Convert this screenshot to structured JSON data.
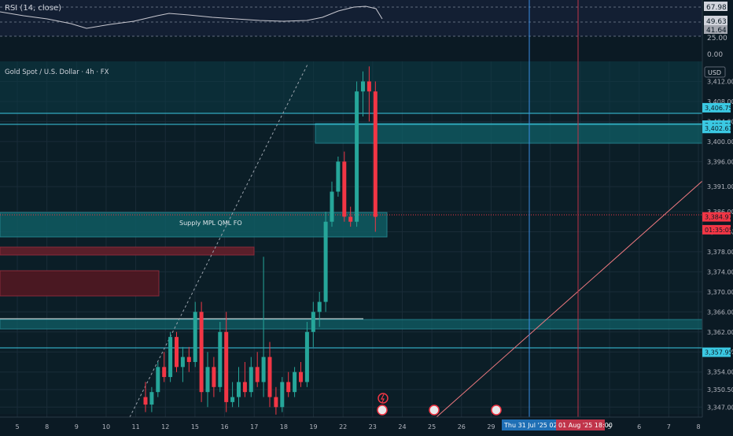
{
  "colors": {
    "background": "#0b1a24",
    "up": "#26a69a",
    "down": "#f23645",
    "zone": "#0e6e74",
    "supply": "#5a1f2a",
    "level": "#3bc9e3",
    "grid": "#1a2c38"
  },
  "rsi": {
    "title": "RSI (14, close)",
    "labels": [
      "67.98",
      "49.63",
      "41.64",
      "25.00",
      "0.00"
    ]
  },
  "symbol": {
    "title": "Gold Spot / U.S. Dollar · 4h · FX",
    "currency": "USD"
  },
  "zones": {
    "supply_label": "Supply MPL QML FO"
  },
  "price_badges": [
    {
      "text": "3,406.75",
      "price": 3406.75,
      "color": "#3bc9e3"
    },
    {
      "text": "3,403.28",
      "price": 3403.28,
      "color": "#3bc9e3"
    },
    {
      "text": "3,402.61",
      "price": 3402.61,
      "color": "#3bc9e3"
    },
    {
      "text": "3,384.97",
      "price": 3384.97,
      "color": "#f23645"
    },
    {
      "text": "01:35:05",
      "price": 3382.4,
      "color": "#f23645"
    },
    {
      "text": "3,357.95",
      "price": 3357.95,
      "color": "#3bc9e3"
    }
  ],
  "crosshair": {
    "time1": "Thu 31 Jul '25   02:00",
    "time2": "01 Aug '25   18:00"
  },
  "chart_data": {
    "type": "candlestick",
    "title": "Gold Spot / U.S. Dollar · 4h · FX",
    "y_ticks": [
      "3,412.00",
      "3,408.00",
      "3,404.00",
      "3,400.00",
      "3,396.00",
      "3,391.00",
      "3,386.00",
      "3,382.00",
      "3,378.00",
      "3,374.00",
      "3,370.00",
      "3,366.00",
      "3,362.00",
      "3,358.00",
      "3,354.00",
      "3,350.50",
      "3,347.00"
    ],
    "x_ticks": [
      "5",
      "8",
      "9",
      "10",
      "11",
      "12",
      "15",
      "16",
      "17",
      "18",
      "19",
      "22",
      "23",
      "24",
      "25",
      "26",
      "29",
      "30",
      "",
      "",
      "5",
      "6",
      "7",
      "8"
    ],
    "ylim": [
      3345,
      3416
    ],
    "candles": [
      {
        "o": 3349,
        "h": 3352,
        "l": 3346,
        "c": 3347.5
      },
      {
        "o": 3347.5,
        "h": 3351,
        "l": 3346,
        "c": 3350
      },
      {
        "o": 3350,
        "h": 3356,
        "l": 3349,
        "c": 3355
      },
      {
        "o": 3355,
        "h": 3358,
        "l": 3352,
        "c": 3353
      },
      {
        "o": 3353,
        "h": 3362,
        "l": 3352,
        "c": 3361
      },
      {
        "o": 3361,
        "h": 3362,
        "l": 3354,
        "c": 3355
      },
      {
        "o": 3355,
        "h": 3359,
        "l": 3352,
        "c": 3357
      },
      {
        "o": 3357,
        "h": 3359,
        "l": 3354,
        "c": 3356
      },
      {
        "o": 3356,
        "h": 3368,
        "l": 3355,
        "c": 3366
      },
      {
        "o": 3366,
        "h": 3368,
        "l": 3348,
        "c": 3350
      },
      {
        "o": 3350,
        "h": 3358,
        "l": 3347,
        "c": 3355
      },
      {
        "o": 3355,
        "h": 3357,
        "l": 3349,
        "c": 3351
      },
      {
        "o": 3351,
        "h": 3364,
        "l": 3350,
        "c": 3362
      },
      {
        "o": 3362,
        "h": 3366,
        "l": 3346,
        "c": 3348
      },
      {
        "o": 3348,
        "h": 3352,
        "l": 3347,
        "c": 3349
      },
      {
        "o": 3349,
        "h": 3355,
        "l": 3347,
        "c": 3352
      },
      {
        "o": 3352,
        "h": 3356,
        "l": 3349,
        "c": 3350
      },
      {
        "o": 3350,
        "h": 3357,
        "l": 3349,
        "c": 3355
      },
      {
        "o": 3355,
        "h": 3358,
        "l": 3351,
        "c": 3352
      },
      {
        "o": 3352,
        "h": 3377,
        "l": 3349,
        "c": 3357
      },
      {
        "o": 3357,
        "h": 3360,
        "l": 3347,
        "c": 3349
      },
      {
        "o": 3349,
        "h": 3351,
        "l": 3345.5,
        "c": 3347
      },
      {
        "o": 3347,
        "h": 3353,
        "l": 3346,
        "c": 3352
      },
      {
        "o": 3352,
        "h": 3354,
        "l": 3349,
        "c": 3350
      },
      {
        "o": 3350,
        "h": 3355,
        "l": 3349,
        "c": 3354
      },
      {
        "o": 3354,
        "h": 3356,
        "l": 3351,
        "c": 3352
      },
      {
        "o": 3352,
        "h": 3364,
        "l": 3351,
        "c": 3362
      },
      {
        "o": 3362,
        "h": 3368,
        "l": 3359,
        "c": 3366
      },
      {
        "o": 3366,
        "h": 3370,
        "l": 3363,
        "c": 3368
      },
      {
        "o": 3368,
        "h": 3386,
        "l": 3366,
        "c": 3384
      },
      {
        "o": 3384,
        "h": 3392,
        "l": 3383,
        "c": 3390
      },
      {
        "o": 3390,
        "h": 3397,
        "l": 3389,
        "c": 3396
      },
      {
        "o": 3396,
        "h": 3398,
        "l": 3384,
        "c": 3385
      },
      {
        "o": 3385,
        "h": 3387,
        "l": 3383,
        "c": 3384
      },
      {
        "o": 3384,
        "h": 3412,
        "l": 3383,
        "c": 3410
      },
      {
        "o": 3410,
        "h": 3414,
        "l": 3405,
        "c": 3412
      },
      {
        "o": 3412,
        "h": 3415,
        "l": 3404,
        "c": 3410
      },
      {
        "o": 3410,
        "h": 3412,
        "l": 3382,
        "c": 3384.97
      }
    ]
  }
}
